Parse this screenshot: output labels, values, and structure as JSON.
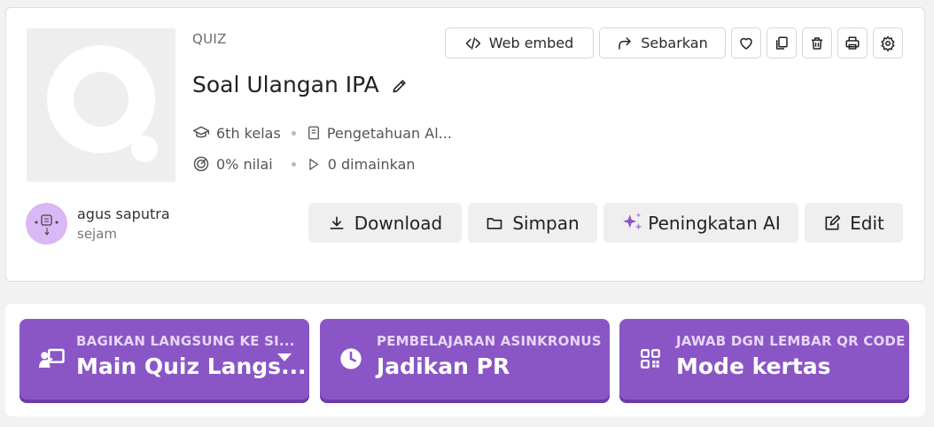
{
  "header": {
    "type_label": "QUIZ",
    "title": "Soal Ulangan IPA",
    "grade": "6th kelas",
    "subject": "Pengetahuan Al...",
    "accuracy": "0% nilai",
    "plays": "0 dimainkan"
  },
  "toolbar": {
    "web_embed_label": "Web embed",
    "share_label": "Sebarkan"
  },
  "author": {
    "name": "agus saputra",
    "time": "sejam"
  },
  "actions": {
    "download_label": "Download",
    "save_label": "Simpan",
    "ai_label": "Peningkatan AI",
    "edit_label": "Edit"
  },
  "modes": [
    {
      "subtitle": "BAGIKAN LANGSUNG KE SI...",
      "title": "Main Quiz Langs..."
    },
    {
      "subtitle": "PEMBELAJARAN ASINKRONUS",
      "title": "Jadikan PR"
    },
    {
      "subtitle": "JAWAB DGN LEMBAR QR CODE",
      "title": "Mode kertas"
    }
  ],
  "colors": {
    "primary": "#8a56c6",
    "primary_shadow": "#6d3ba8",
    "ai_sparkle": "#8a56c6"
  }
}
